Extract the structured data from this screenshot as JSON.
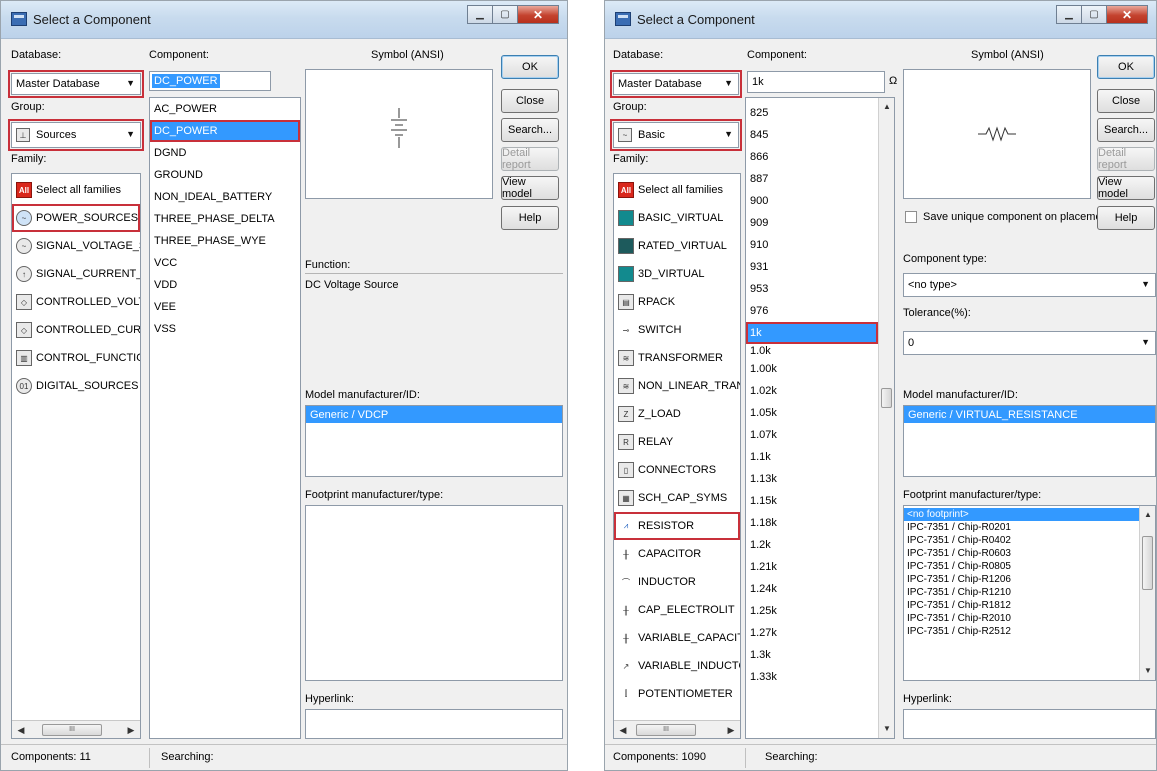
{
  "dialogs": [
    {
      "title": "Select a Component",
      "database_label": "Database:",
      "database_value": "Master Database",
      "group_label": "Group:",
      "group_value": "Sources",
      "family_label": "Family:",
      "families": [
        "Select all families",
        "POWER_SOURCES",
        "SIGNAL_VOLTAGE_SOURC",
        "SIGNAL_CURRENT_SOURC",
        "CONTROLLED_VOLTAGE_:",
        "CONTROLLED_CURRENT_",
        "CONTROL_FUNCTION_BL",
        "DIGITAL_SOURCES"
      ],
      "component_label": "Component:",
      "component_value": "DC_POWER",
      "components": [
        "AC_POWER",
        "DC_POWER",
        "DGND",
        "GROUND",
        "NON_IDEAL_BATTERY",
        "THREE_PHASE_DELTA",
        "THREE_PHASE_WYE",
        "VCC",
        "VDD",
        "VEE",
        "VSS"
      ],
      "symbol_label": "Symbol (ANSI)",
      "function_label": "Function:",
      "function_value": "DC Voltage Source",
      "model_label": "Model manufacturer/ID:",
      "model_value": "Generic / VDCP",
      "footprint_label": "Footprint manufacturer/type:",
      "hyperlink_label": "Hyperlink:",
      "buttons": {
        "ok": "OK",
        "close": "Close",
        "search": "Search...",
        "detail": "Detail report",
        "view": "View model",
        "help": "Help"
      },
      "status_count": "Components: 11",
      "status_search": "Searching:",
      "scroll_grip": "III"
    },
    {
      "title": "Select a Component",
      "database_label": "Database:",
      "database_value": "Master Database",
      "group_label": "Group:",
      "group_value": "Basic",
      "family_label": "Family:",
      "families": [
        "Select all families",
        "BASIC_VIRTUAL",
        "RATED_VIRTUAL",
        "3D_VIRTUAL",
        "RPACK",
        "SWITCH",
        "TRANSFORMER",
        "NON_LINEAR_TRANSFOR",
        "Z_LOAD",
        "RELAY",
        "CONNECTORS",
        "SCH_CAP_SYMS",
        "RESISTOR",
        "CAPACITOR",
        "INDUCTOR",
        "CAP_ELECTROLIT",
        "VARIABLE_CAPACITOR",
        "VARIABLE_INDUCTOR",
        "POTENTIOMETER"
      ],
      "component_label": "Component:",
      "component_value": "1k",
      "omega": "Ω",
      "components": [
        "825",
        "845",
        "866",
        "887",
        "900",
        "909",
        "910",
        "931",
        "953",
        "976",
        "1k",
        "1.0k",
        "1.00k",
        "1.02k",
        "1.05k",
        "1.07k",
        "1.1k",
        "1.13k",
        "1.15k",
        "1.18k",
        "1.2k",
        "1.21k",
        "1.24k",
        "1.25k",
        "1.27k",
        "1.3k",
        "1.33k"
      ],
      "symbol_label": "Symbol (ANSI)",
      "save_unique_label": "Save unique component on placement",
      "component_type_label": "Component type:",
      "component_type_value": "<no type>",
      "tolerance_label": "Tolerance(%):",
      "tolerance_value": "0",
      "model_label": "Model manufacturer/ID:",
      "model_value": "Generic / VIRTUAL_RESISTANCE",
      "footprint_label": "Footprint manufacturer/type:",
      "footprints": [
        "<no footprint>",
        "IPC-7351 / Chip-R0201",
        "IPC-7351 / Chip-R0402",
        "IPC-7351 / Chip-R0603",
        "IPC-7351 / Chip-R0805",
        "IPC-7351 / Chip-R1206",
        "IPC-7351 / Chip-R1210",
        "IPC-7351 / Chip-R1812",
        "IPC-7351 / Chip-R2010",
        "IPC-7351 / Chip-R2512"
      ],
      "hyperlink_label": "Hyperlink:",
      "buttons": {
        "ok": "OK",
        "close": "Close",
        "search": "Search...",
        "detail": "Detail report",
        "view": "View model",
        "help": "Help"
      },
      "status_count": "Components: 1090",
      "status_search": "Searching:",
      "scroll_grip": "III"
    }
  ],
  "colors": {
    "highlight": "#3399ff",
    "red_outline": "#c8303a"
  }
}
